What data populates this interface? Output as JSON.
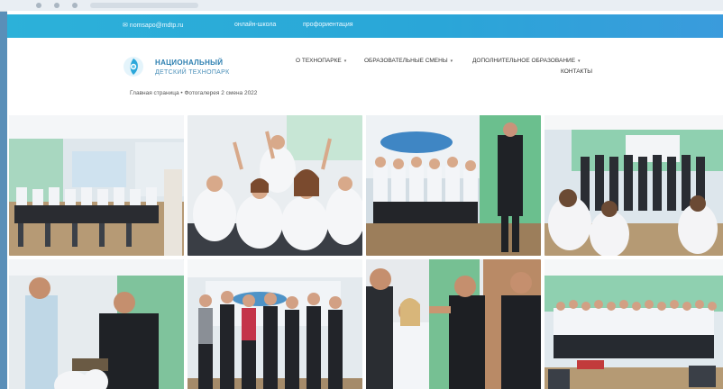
{
  "topbar": {
    "email": "✉ nomsapo@mdtp.ru",
    "link_2": "онлайн-школа",
    "link_3": "профориентация"
  },
  "logo": {
    "line1": "НАЦИОНАЛЬНЫЙ",
    "line2": "ДЕТСКИЙ ТЕХНОПАРК"
  },
  "nav": {
    "items": [
      {
        "label": "О ТЕХНОПАРКЕ",
        "has_dropdown": true
      },
      {
        "label": "ОБРАЗОВАТЕЛЬНЫЕ СМЕНЫ",
        "has_dropdown": true
      },
      {
        "label": "ДОПОЛНИТЕЛЬНОЕ ОБРАЗОВАНИЕ",
        "has_dropdown": true
      },
      {
        "label": "КОНТАКТЫ",
        "has_dropdown": false
      }
    ]
  },
  "breadcrumb": "Главная страница • Фотогалерея 2 смена 2022",
  "gallery": {
    "photos": [
      {
        "subject": "classroom-students-seated"
      },
      {
        "subject": "students-raising-hands"
      },
      {
        "subject": "students-seated-speaker-standing"
      },
      {
        "subject": "hall-audience-students"
      },
      {
        "subject": "award-handover"
      },
      {
        "subject": "group-standing-banner"
      },
      {
        "subject": "high-five-greeting"
      },
      {
        "subject": "group-photo-hall"
      }
    ]
  },
  "colors": {
    "topbar": "#2aa6d8",
    "brand_blue": "#2d7fb0",
    "wall_green": "#7cc39a",
    "uniform_white": "#f2f4f7",
    "dark_suit": "#23262b"
  }
}
